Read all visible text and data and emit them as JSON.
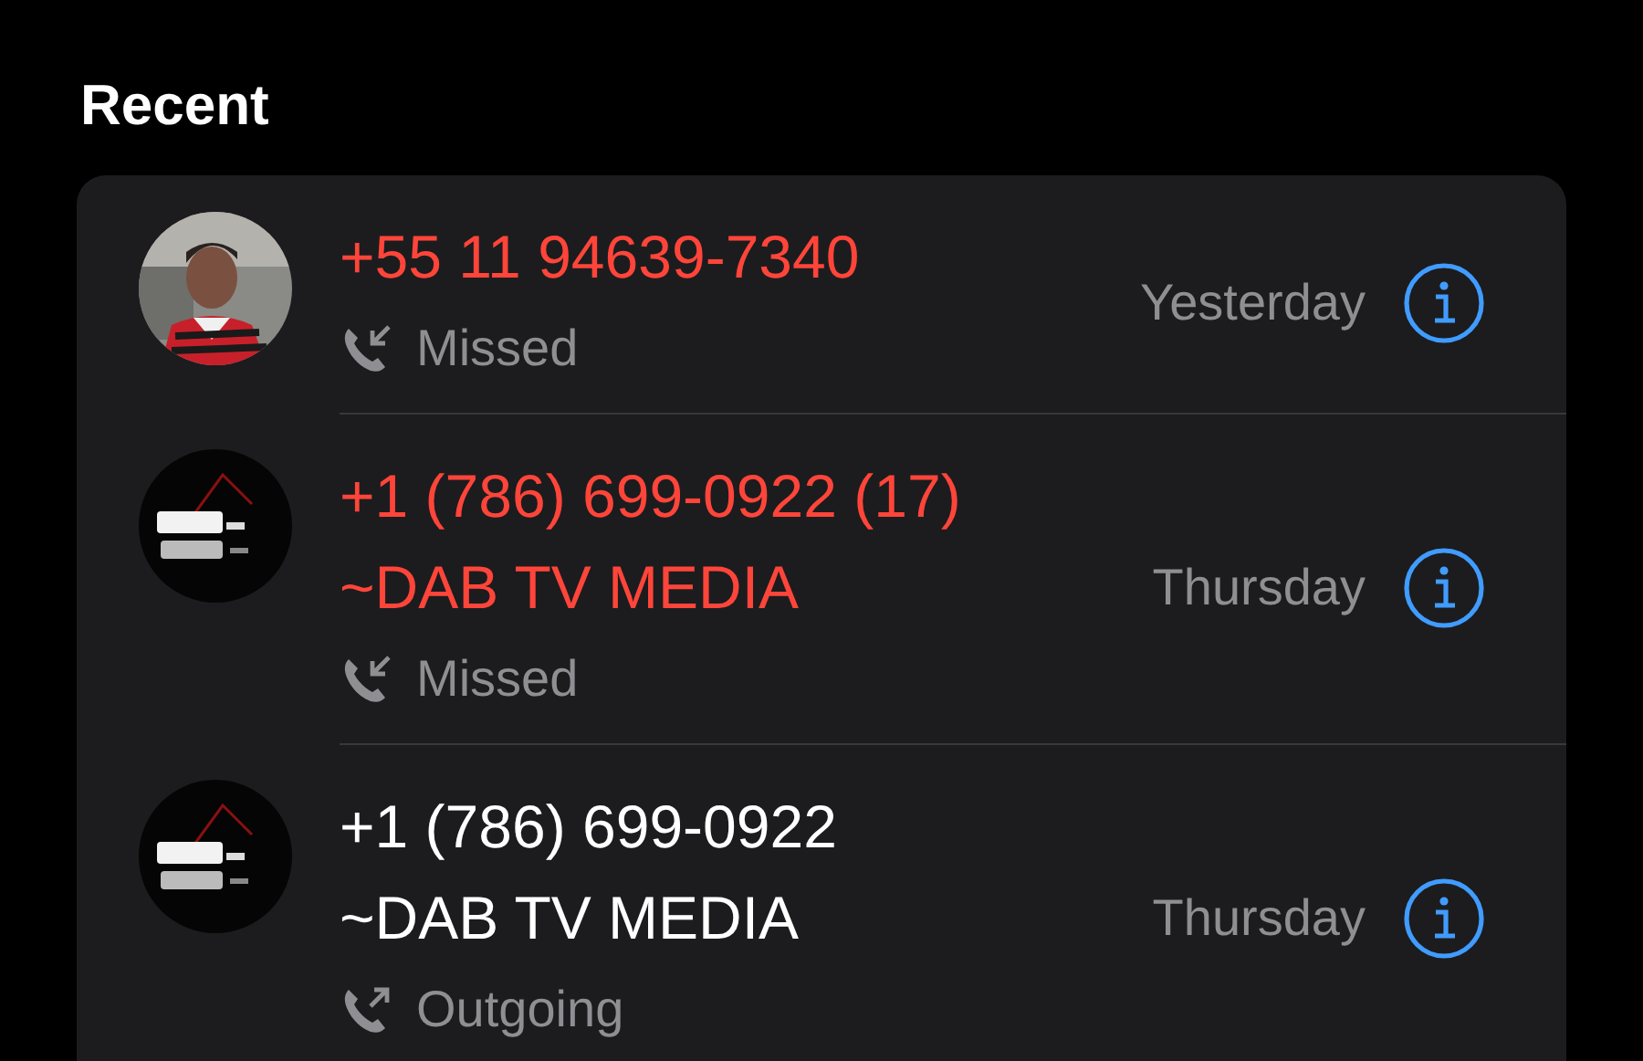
{
  "header": {
    "title": "Recent"
  },
  "calls": [
    {
      "avatar": {
        "kind": "person"
      },
      "kind": "missed",
      "lines": [
        "+55 11 94639-7340"
      ],
      "status": "Missed",
      "date": "Yesterday"
    },
    {
      "avatar": {
        "kind": "logo"
      },
      "kind": "missed",
      "lines": [
        "+1 (786) 699-0922 (17)",
        "~DAB TV MEDIA"
      ],
      "status": "Missed",
      "date": "Thursday"
    },
    {
      "avatar": {
        "kind": "logo"
      },
      "kind": "outgoing",
      "lines": [
        "+1 (786) 699-0922",
        "~DAB TV MEDIA"
      ],
      "status": "Outgoing",
      "date": "Thursday"
    }
  ]
}
